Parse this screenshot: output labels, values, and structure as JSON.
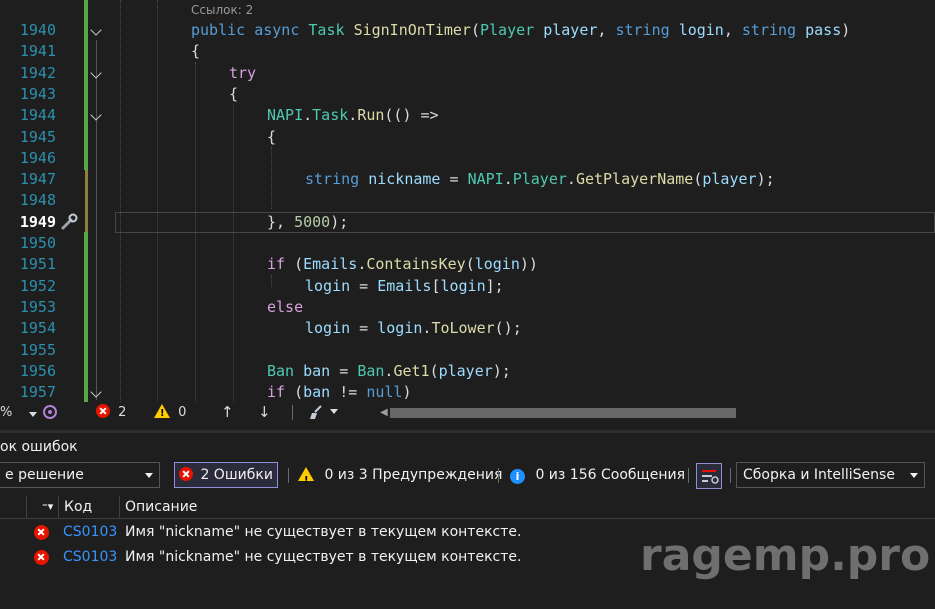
{
  "editor": {
    "codelens": "Ссылок: 2",
    "lines": [
      {
        "num": "1940",
        "tokens": [
          [
            "k",
            "public "
          ],
          [
            "k",
            "async "
          ],
          [
            "t",
            "Task "
          ],
          [
            "m",
            "SignInOnTimer"
          ],
          [
            "p",
            "("
          ],
          [
            "t",
            "Player "
          ],
          [
            "v",
            "player"
          ],
          [
            "p",
            ", "
          ],
          [
            "k",
            "string "
          ],
          [
            "v",
            "login"
          ],
          [
            "p",
            ", "
          ],
          [
            "k",
            "string "
          ],
          [
            "v",
            "pass"
          ],
          [
            "p",
            ")"
          ]
        ]
      },
      {
        "num": "1941",
        "tokens": [
          [
            "p",
            "{"
          ]
        ]
      },
      {
        "num": "1942",
        "tokens": [
          [
            "kc",
            "try"
          ]
        ]
      },
      {
        "num": "1943",
        "tokens": [
          [
            "p",
            "{"
          ]
        ]
      },
      {
        "num": "1944",
        "tokens": [
          [
            "t",
            "NAPI"
          ],
          [
            "p",
            "."
          ],
          [
            "t",
            "Task"
          ],
          [
            "p",
            "."
          ],
          [
            "m",
            "Run"
          ],
          [
            "p",
            "(() =>"
          ]
        ]
      },
      {
        "num": "1945",
        "tokens": [
          [
            "p",
            "{"
          ]
        ]
      },
      {
        "num": "1946",
        "tokens": []
      },
      {
        "num": "1947",
        "tokens": [
          [
            "k",
            "string "
          ],
          [
            "v",
            "nickname"
          ],
          [
            "p",
            " = "
          ],
          [
            "t",
            "NAPI"
          ],
          [
            "p",
            "."
          ],
          [
            "t",
            "Player"
          ],
          [
            "p",
            "."
          ],
          [
            "m",
            "GetPlayerName"
          ],
          [
            "p",
            "("
          ],
          [
            "v",
            "player"
          ],
          [
            "p",
            ");"
          ]
        ]
      },
      {
        "num": "1948",
        "tokens": []
      },
      {
        "num": "1949",
        "tokens": [
          [
            "p",
            "}, "
          ],
          [
            "n",
            "5000"
          ],
          [
            "p",
            ");"
          ]
        ]
      },
      {
        "num": "1950",
        "tokens": []
      },
      {
        "num": "1951",
        "tokens": [
          [
            "kc",
            "if "
          ],
          [
            "p",
            "("
          ],
          [
            "v",
            "Emails"
          ],
          [
            "p",
            "."
          ],
          [
            "m",
            "ContainsKey"
          ],
          [
            "p",
            "("
          ],
          [
            "v",
            "login"
          ],
          [
            "p",
            "))"
          ]
        ]
      },
      {
        "num": "1952",
        "tokens": [
          [
            "v",
            "login"
          ],
          [
            "p",
            " = "
          ],
          [
            "v",
            "Emails"
          ],
          [
            "p",
            "["
          ],
          [
            "v",
            "login"
          ],
          [
            "p",
            "];"
          ]
        ]
      },
      {
        "num": "1953",
        "tokens": [
          [
            "kc",
            "else"
          ]
        ]
      },
      {
        "num": "1954",
        "tokens": [
          [
            "v",
            "login"
          ],
          [
            "p",
            " = "
          ],
          [
            "v",
            "login"
          ],
          [
            "p",
            "."
          ],
          [
            "m",
            "ToLower"
          ],
          [
            "p",
            "();"
          ]
        ]
      },
      {
        "num": "1955",
        "tokens": []
      },
      {
        "num": "1956",
        "tokens": [
          [
            "t",
            "Ban "
          ],
          [
            "v",
            "ban"
          ],
          [
            "p",
            " = "
          ],
          [
            "t",
            "Ban"
          ],
          [
            "p",
            "."
          ],
          [
            "m",
            "Get1"
          ],
          [
            "p",
            "("
          ],
          [
            "v",
            "player"
          ],
          [
            "p",
            ");"
          ]
        ]
      },
      {
        "num": "1957",
        "tokens": [
          [
            "kc",
            "if "
          ],
          [
            "p",
            "("
          ],
          [
            "v",
            "ban"
          ],
          [
            "p",
            " != "
          ],
          [
            "k",
            "null"
          ],
          [
            "p",
            ")"
          ]
        ]
      }
    ]
  },
  "status": {
    "zoom_fragment": "%",
    "errors": "2",
    "warnings": "0"
  },
  "error_list": {
    "title": "ок ошибок",
    "scope": "е решение",
    "errors_btn": "2 Ошибки",
    "warnings_btn": "0 из 3 Предупреждения",
    "messages_btn": "0 из 156 Сообщения",
    "build_filter": "Сборка и IntelliSense",
    "col_code": "Код",
    "col_desc": "Описание",
    "rows": [
      {
        "code": "CS0103",
        "desc": "Имя \"nickname\" не существует в текущем контексте."
      },
      {
        "code": "CS0103",
        "desc": "Имя \"nickname\" не существует в текущем контексте."
      }
    ]
  },
  "watermark": "ragemp.pro",
  "colors": {
    "accent_green": "#57a64a",
    "error_red": "#e51400",
    "link_blue": "#3794ff"
  }
}
